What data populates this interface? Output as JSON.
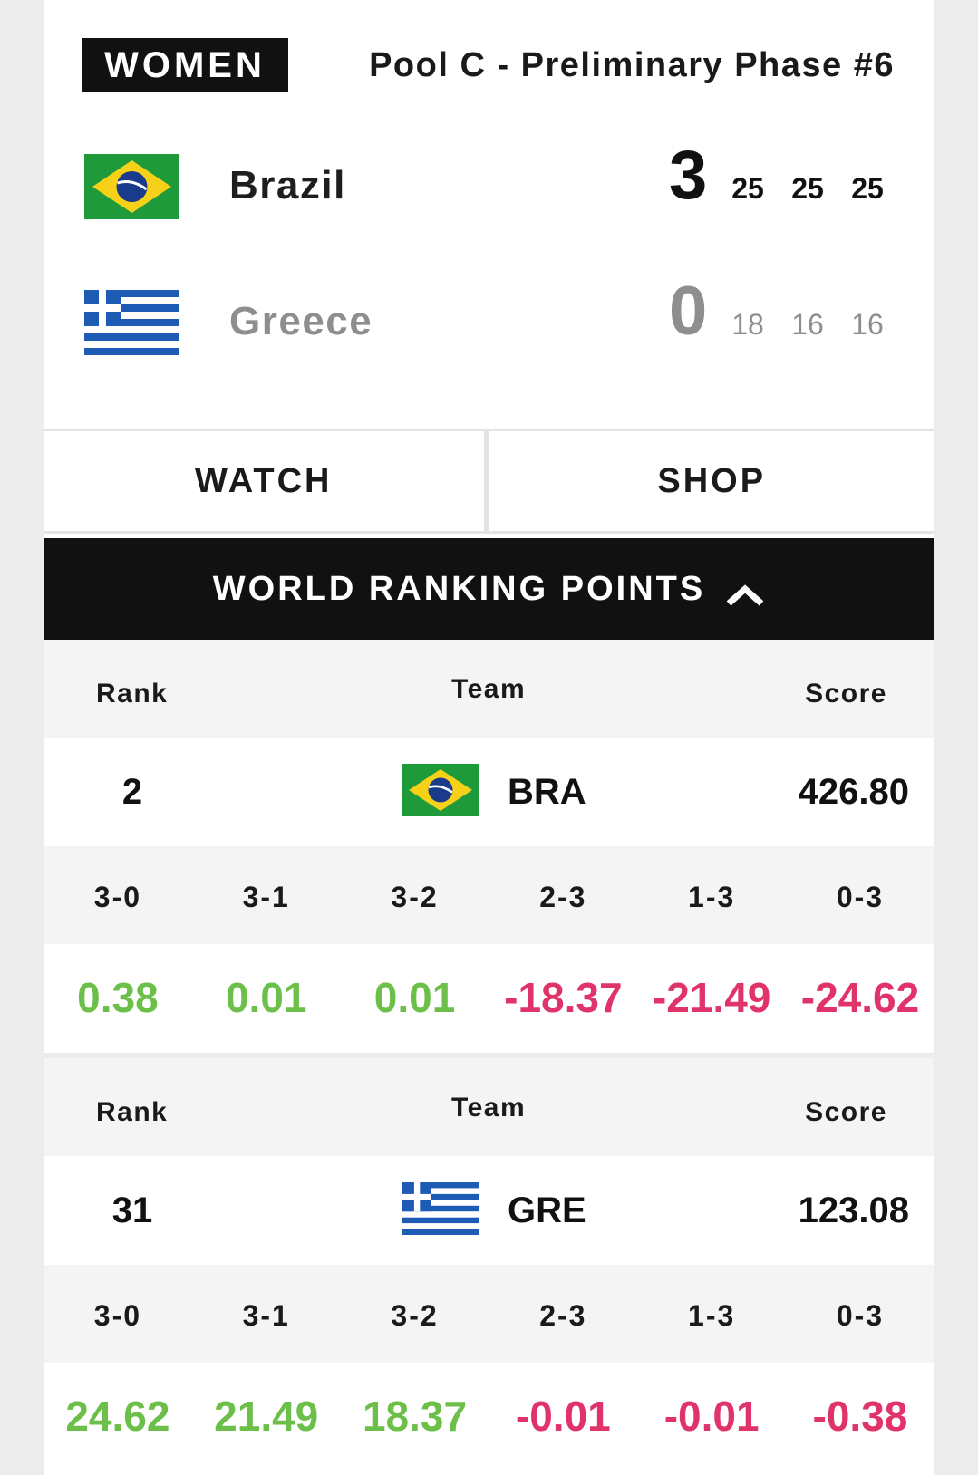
{
  "match": {
    "category": "WOMEN",
    "phase": "Pool C - Preliminary Phase #6",
    "teams": [
      {
        "name": "Brazil",
        "sets_won": "3",
        "set_scores": [
          "25",
          "25",
          "25"
        ],
        "flag": "brazil-flag"
      },
      {
        "name": "Greece",
        "sets_won": "0",
        "set_scores": [
          "18",
          "16",
          "16"
        ],
        "flag": "greece-flag"
      }
    ]
  },
  "actions": {
    "watch_label": "WATCH",
    "shop_label": "SHOP"
  },
  "ranking": {
    "title": "WORLD RANKING POINTS",
    "toggle_icon": "chevron-up-icon",
    "headers": {
      "rank": "Rank",
      "team": "Team",
      "score": "Score"
    },
    "result_labels": [
      "3-0",
      "3-1",
      "3-2",
      "2-3",
      "1-3",
      "0-3"
    ],
    "entries": [
      {
        "rank": "2",
        "code": "BRA",
        "score": "426.80",
        "deltas": [
          "0.38",
          "0.01",
          "0.01",
          "-18.37",
          "-21.49",
          "-24.62"
        ]
      },
      {
        "rank": "31",
        "code": "GRE",
        "score": "123.08",
        "deltas": [
          "24.62",
          "21.49",
          "18.37",
          "-0.01",
          "-0.01",
          "-0.38"
        ]
      }
    ]
  },
  "colors": {
    "positive": "#6cc04a",
    "negative": "#e0336a",
    "dark": "#111111",
    "muted": "#8e8e8e"
  }
}
